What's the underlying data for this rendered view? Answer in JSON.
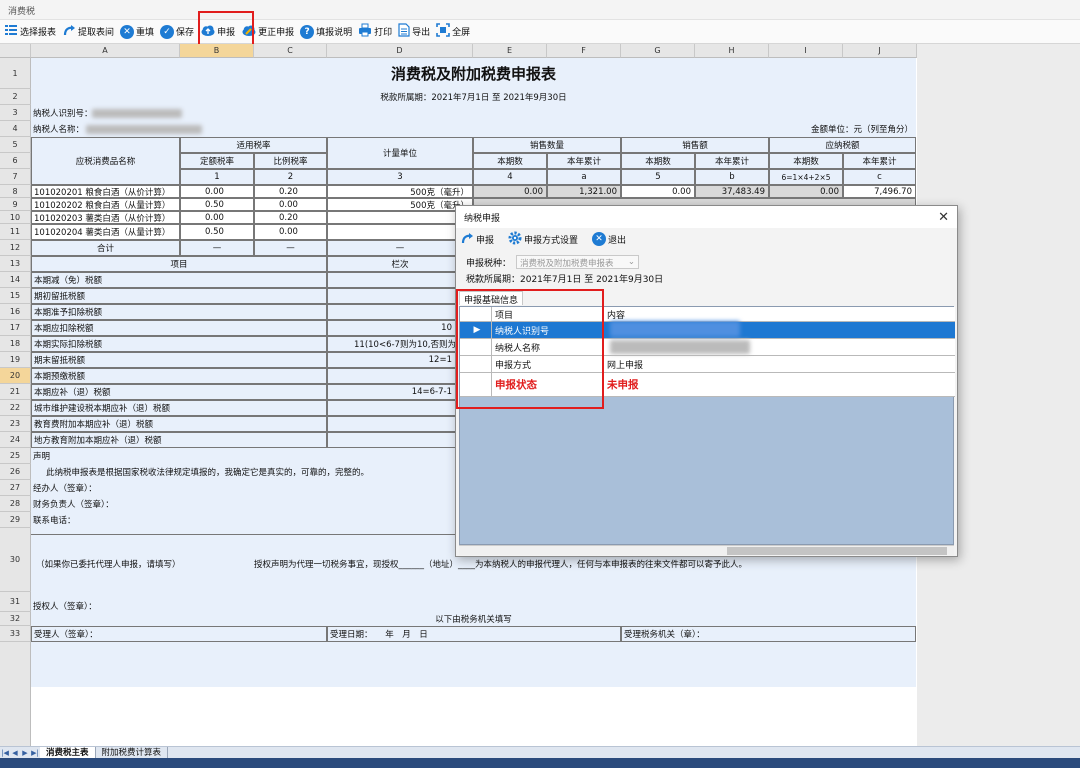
{
  "window": {
    "title": "消费税"
  },
  "toolbar": {
    "items": [
      {
        "label": "选择报表",
        "icon": "grid-icon"
      },
      {
        "label": "提取表间",
        "icon": "redo-arrow-icon"
      },
      {
        "label": "重填",
        "icon": "clear-circle-icon"
      },
      {
        "label": "保存",
        "icon": "check-circle-icon"
      },
      {
        "label": "申报",
        "icon": "cloud-upload-icon"
      },
      {
        "label": "更正申报",
        "icon": "cloud-edit-icon"
      },
      {
        "label": "填报说明",
        "icon": "help-circle-icon"
      },
      {
        "label": "打印",
        "icon": "printer-icon"
      },
      {
        "label": "导出",
        "icon": "document-icon"
      },
      {
        "label": "全屏",
        "icon": "fullscreen-icon"
      }
    ]
  },
  "columns": [
    "A",
    "B",
    "C",
    "D",
    "E",
    "F",
    "G",
    "H",
    "I",
    "J"
  ],
  "rows": [
    "1",
    "2",
    "3",
    "4",
    "5",
    "6",
    "7",
    "8",
    "9",
    "10",
    "11",
    "12",
    "13",
    "14",
    "15",
    "16",
    "17",
    "18",
    "19",
    "20",
    "21",
    "22",
    "23",
    "24",
    "25",
    "26",
    "27",
    "28",
    "29",
    "30",
    "31",
    "32",
    "33"
  ],
  "form": {
    "title": "消费税及附加税费申报表",
    "period": "税款所属期：2021年7月1日 至 2021年9月30日",
    "taxpayer_id_label": "纳税人识别号：",
    "taxpayer_name_label": "纳税人名称：",
    "unit": "金额单位：元（列至角分）",
    "headers": {
      "product": "应税消费品名称",
      "rate": "适用税率",
      "fixed_rate": "定额税率",
      "prop_rate": "比例税率",
      "unit_measure": "计量单位",
      "sales_qty": "销售数量",
      "sales_amt": "销售额",
      "tax_payable": "应纳税额",
      "current": "本期数",
      "ytd": "本年累计",
      "num1": "1",
      "num2": "2",
      "num3": "3",
      "num4": "4",
      "numa": "a",
      "num5": "5",
      "numb": "b",
      "num6": "6=1×4+2×5",
      "numc": "c"
    },
    "products": [
      {
        "name": "101020201 粮食白酒（从价计算）",
        "fixed": "0.00",
        "prop": "0.20",
        "unit": "500克（毫升）",
        "qty": "0.00",
        "qty_ytd": "1,321.00",
        "amt": "0.00",
        "amt_ytd": "37,483.49",
        "tax": "0.00",
        "tax_ytd": "7,496.70"
      },
      {
        "name": "101020202 粮食白酒（从量计算）",
        "fixed": "0.50",
        "prop": "0.00",
        "unit": "500克（毫升）",
        "qty": "",
        "qty_ytd": "",
        "amt": "",
        "amt_ytd": "",
        "tax": "",
        "tax_ytd": ""
      },
      {
        "name": "101020203 薯类白酒（从价计算）",
        "fixed": "0.00",
        "prop": "0.20",
        "unit": "",
        "qty": "",
        "qty_ytd": "",
        "amt": "",
        "amt_ytd": "",
        "tax": "",
        "tax_ytd": ""
      },
      {
        "name": "101020204 薯类白酒（从量计算）",
        "fixed": "0.50",
        "prop": "0.00",
        "unit": "",
        "qty": "",
        "qty_ytd": "",
        "amt": "",
        "amt_ytd": "",
        "tax": "",
        "tax_ytd": ""
      }
    ],
    "total_label": "合计",
    "dash": "—",
    "item_label": "项目",
    "col_label": "栏次",
    "items": [
      {
        "label": "本期减（免）税额",
        "col": ""
      },
      {
        "label": "期初留抵税额",
        "col": ""
      },
      {
        "label": "本期准予扣除税额",
        "col": ""
      },
      {
        "label": "本期应扣除税额",
        "col": "10"
      },
      {
        "label": "本期实际扣除税额",
        "col": "11(10<6-7则为10,否则为6"
      },
      {
        "label": "期末留抵税额",
        "col": "12=1"
      },
      {
        "label": "本期预缴税额",
        "col": ""
      },
      {
        "label": "本期应补（退）税额",
        "col": "14=6-7-1"
      },
      {
        "label": "城市维护建设税本期应补（退）税额",
        "col": ""
      },
      {
        "label": "教育费附加本期应补（退）税额",
        "col": ""
      },
      {
        "label": "地方教育附加本期应补（退）税额",
        "col": ""
      }
    ],
    "declaration": "声明",
    "declaration_text": "此纳税申报表是根据国家税收法律规定填报的，我确定它是真实的，可靠的，完整的。",
    "agent_sign": "经办人（签章）：",
    "finance_sign": "财务负责人（签章）：",
    "phone": "联系电话：",
    "agent_note": "（如果你已委托代理人申报，请填写）",
    "auth_text": "授权声明为代理一切税务事宜，现授权______（地址）____为本纳税人的申报代理人，任何与本申报表的往来文件都可以寄予此人。",
    "auth_sign": "授权人（签章）：",
    "office_fill": "以下由税务机关填写",
    "receiver": "受理人（签章）：",
    "receive_date": "受理日期：　　年　月　日",
    "receive_office": "受理税务机关（章）："
  },
  "sheet_tabs": [
    "消费税主表",
    "附加税费计算表"
  ],
  "dialog": {
    "title": "纳税申报",
    "buttons": [
      {
        "label": "申报",
        "icon": "redo-arrow-icon"
      },
      {
        "label": "申报方式设置",
        "icon": "gear-icon"
      },
      {
        "label": "退出",
        "icon": "close-circle-icon"
      }
    ],
    "tax_type_label": "申报税种：",
    "tax_type_value": "消费税及附加税费申报表",
    "period": "税款所属期：2021年7月1日 至 2021年9月30日",
    "group_tab": "申报基础信息",
    "grid_header": {
      "item": "项目",
      "content": "内容"
    },
    "grid_rows": [
      {
        "item": "纳税人识别号",
        "content": ""
      },
      {
        "item": "纳税人名称",
        "content": ""
      },
      {
        "item": "申报方式",
        "content": "网上申报"
      },
      {
        "item": "申报状态",
        "content": "未申报"
      }
    ]
  },
  "colors": {
    "highlight": "#e11d1d",
    "select": "#1e78d2",
    "form_bg": "#e8f0fb"
  }
}
